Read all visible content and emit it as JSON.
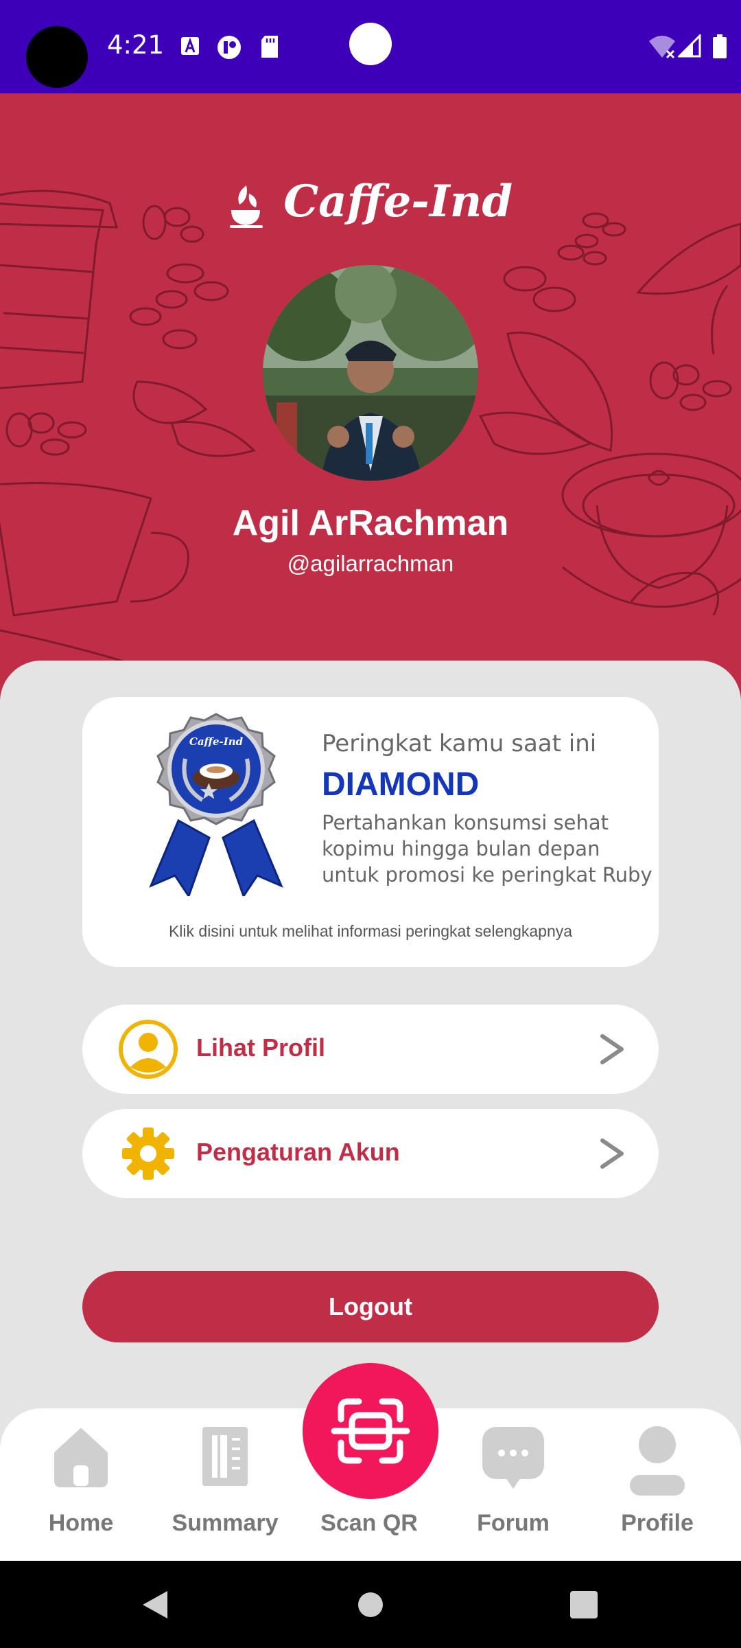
{
  "status_bar": {
    "time": "4:21",
    "icons": [
      "accessibility-icon",
      "circle-app-icon",
      "sd-card-icon",
      "wifi-off-icon",
      "signal-icon",
      "battery-icon"
    ]
  },
  "header": {
    "brand": "Caffe-Ind",
    "user_name": "Agil ArRachman",
    "user_handle": "@agilarrachman",
    "colors": {
      "header_bg": "#bf2e46",
      "status_bg": "#3d00b8"
    }
  },
  "rank_card": {
    "heading": "Peringkat kamu saat ini",
    "level": "DIAMOND",
    "description": "Pertahankan konsumsi sehat kopimu hingga bulan depan untuk promosi ke peringkat Ruby",
    "more_info": "Klik disini untuk melihat informasi peringkat selengkapnya",
    "medal_brand": "Caffe-Ind"
  },
  "menu": [
    {
      "label": "Lihat Profil",
      "icon": "user-circle-icon"
    },
    {
      "label": "Pengaturan Akun",
      "icon": "gear-icon"
    }
  ],
  "logout_label": "Logout",
  "nav": [
    {
      "label": "Home",
      "icon": "home-icon"
    },
    {
      "label": "Summary",
      "icon": "summary-icon"
    },
    {
      "label": "Scan QR",
      "icon": "scan-qr-icon"
    },
    {
      "label": "Forum",
      "icon": "chat-bubble-icon"
    },
    {
      "label": "Profile",
      "icon": "person-icon"
    }
  ],
  "system_nav": [
    "back-icon",
    "home-circle-icon",
    "recents-icon"
  ]
}
